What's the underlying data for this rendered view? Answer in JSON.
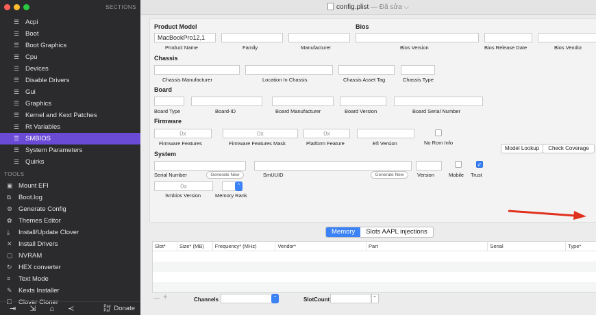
{
  "window": {
    "title": "config.plist",
    "edited": " — Đã sửa ⌵"
  },
  "sidebar": {
    "header": "SECTIONS",
    "items": [
      {
        "label": "Acpi"
      },
      {
        "label": "Boot"
      },
      {
        "label": "Boot Graphics"
      },
      {
        "label": "Cpu"
      },
      {
        "label": "Devices"
      },
      {
        "label": "Disable Drivers"
      },
      {
        "label": "Gui"
      },
      {
        "label": "Graphics"
      },
      {
        "label": "Kernel and Kext Patches"
      },
      {
        "label": "Rt Variables"
      },
      {
        "label": "SMBIOS"
      },
      {
        "label": "System Parameters"
      },
      {
        "label": "Quirks"
      }
    ],
    "tools_header": "TOOLS",
    "tools": [
      {
        "label": "Mount EFI",
        "icon": "disk-icon",
        "glyph": "▣"
      },
      {
        "label": "Boot.log",
        "icon": "log-icon",
        "glyph": "⧉"
      },
      {
        "label": "Generate Config",
        "icon": "config-icon",
        "glyph": "⚙"
      },
      {
        "label": "Themes Editor",
        "icon": "palette-icon",
        "glyph": "✿"
      },
      {
        "label": "Install/Update Clover",
        "icon": "download-icon",
        "glyph": "⤓"
      },
      {
        "label": "Install Drivers",
        "icon": "tools-icon",
        "glyph": "✕"
      },
      {
        "label": "NVRAM",
        "icon": "chip-icon",
        "glyph": "▢"
      },
      {
        "label": "HEX converter",
        "icon": "refresh-icon",
        "glyph": "↻"
      },
      {
        "label": "Text Mode",
        "icon": "text-icon",
        "glyph": "≡"
      },
      {
        "label": "Kexts Installer",
        "icon": "wrench-icon",
        "glyph": "✎"
      },
      {
        "label": "Clover Cloner",
        "icon": "clone-icon",
        "glyph": "⧠"
      }
    ],
    "donate": "Donate",
    "donate_pay": "Pay Pal"
  },
  "product": {
    "header": "Product Model",
    "product_name_value": "MacBookPro12,1",
    "product_name_label": "Product Name",
    "family_label": "Family",
    "manufacturer_label": "Manufacturer"
  },
  "bios": {
    "header": "Bios",
    "version_label": "Bios Version",
    "release_date_label": "Bios Release Date",
    "vendor_label": "Bios Vendor"
  },
  "chassis": {
    "header": "Chassis",
    "manufacturer_label": "Chassis Manufacturer",
    "location_label": "Location In Chassis",
    "asset_tag_label": "Chassis  Asset Tag",
    "type_label": "Chassis Type"
  },
  "board": {
    "header": "Board",
    "type_label": "Board Type",
    "id_label": "Board-ID",
    "manufacturer_label": "Board Manufacturer",
    "version_label": "Board Version",
    "serial_label": "Board Serial Number"
  },
  "firmware": {
    "header": "Firmware",
    "features_value": "0x",
    "features_label": "Firmware Features",
    "mask_value": "0x",
    "mask_label": "Firmware Features Mask",
    "platform_value": "0x",
    "platform_label": "Platform Feature",
    "efi_label": "Efi Version",
    "no_rom_label": "No Rom Info"
  },
  "buttons": {
    "model_lookup": "Model Lookup",
    "check_coverage": "Check Coverage",
    "generate_new": "Generate New",
    "side": "<"
  },
  "system": {
    "header": "System",
    "serial_label": "Serial Number",
    "smuuid_label": "SmUUID",
    "version_label": "Version",
    "mobile_label": "Mobile",
    "trust_label": "Trust",
    "smbios_version_value": "0x",
    "smbios_version_label": "Smbios Version",
    "memory_rank_label": "Memory Rank"
  },
  "memory_tabs": [
    {
      "label": "Memory"
    },
    {
      "label": "Slots AAPL injections"
    }
  ],
  "memory_table": {
    "columns": [
      {
        "label": "Slot*"
      },
      {
        "label": "Size* (MB)"
      },
      {
        "label": "Frequency* (MHz)"
      },
      {
        "label": "Vendor*"
      },
      {
        "label": "Part"
      },
      {
        "label": "Serial"
      },
      {
        "label": "Type*"
      }
    ]
  },
  "footer": {
    "minus": "—",
    "plus": "+",
    "channels_label": "Channels",
    "slotcount_label": "SlotCount"
  },
  "colors": {
    "selected": "#6a4bd6",
    "accent": "#3b82f6",
    "arrow": "#e0301e"
  }
}
